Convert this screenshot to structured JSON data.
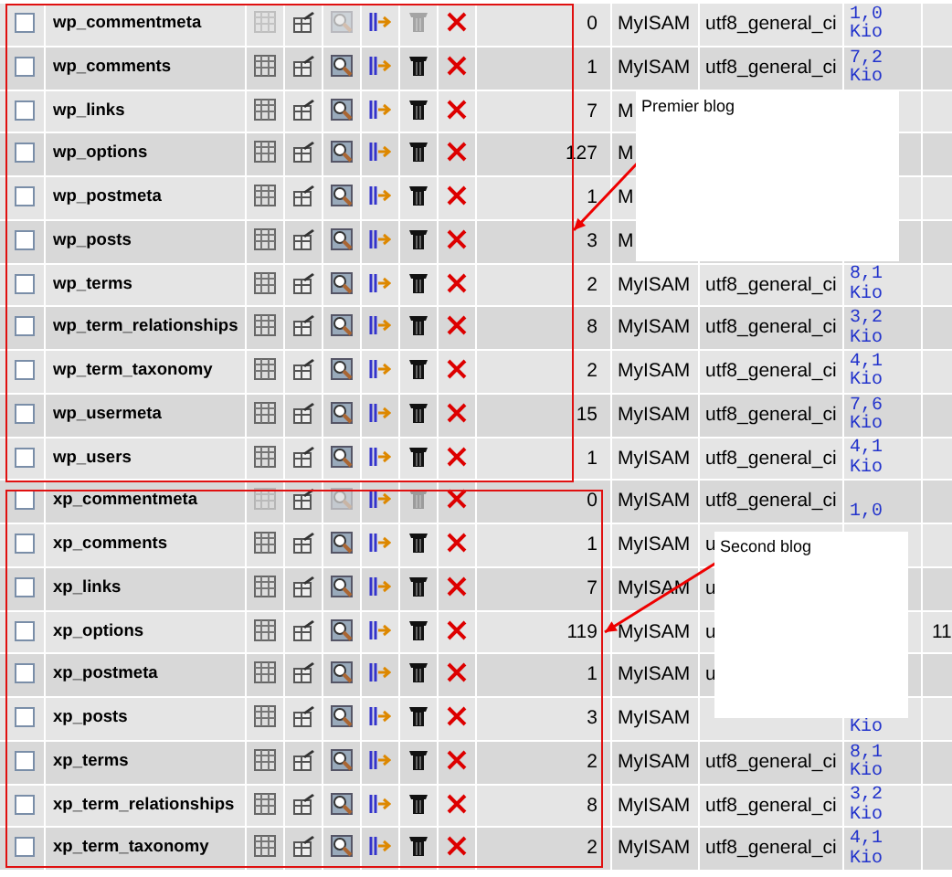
{
  "groups": [
    {
      "label": "Premier blog",
      "rows": [
        {
          "name": "wp_commentmeta",
          "checked": false,
          "records": "0",
          "engine": "MyISAM",
          "collation": "utf8_general_ci",
          "size": "1,0 Kio",
          "icons_disabled": true
        },
        {
          "name": "wp_comments",
          "checked": false,
          "records": "1",
          "engine": "MyISAM",
          "collation": "utf8_general_ci",
          "size": "7,2 Kio",
          "icons_disabled": false
        },
        {
          "name": "wp_links",
          "checked": false,
          "records": "7",
          "engine": "M",
          "icons_disabled": false
        },
        {
          "name": "wp_options",
          "checked": false,
          "records": "127",
          "engine": "M",
          "icons_disabled": false
        },
        {
          "name": "wp_postmeta",
          "checked": false,
          "records": "1",
          "engine": "M",
          "icons_disabled": false
        },
        {
          "name": "wp_posts",
          "checked": false,
          "records": "3",
          "engine": "M",
          "icons_disabled": false
        },
        {
          "name": "wp_terms",
          "checked": false,
          "records": "2",
          "engine": "MyISAM",
          "collation": "utf8_general_ci",
          "size": "8,1 Kio",
          "icons_disabled": false
        },
        {
          "name": "wp_term_relationships",
          "checked": false,
          "records": "8",
          "engine": "MyISAM",
          "collation": "utf8_general_ci",
          "size": "3,2 Kio",
          "icons_disabled": false
        },
        {
          "name": "wp_term_taxonomy",
          "checked": false,
          "records": "2",
          "engine": "MyISAM",
          "collation": "utf8_general_ci",
          "size": "4,1 Kio",
          "icons_disabled": false
        },
        {
          "name": "wp_usermeta",
          "checked": false,
          "records": "15",
          "engine": "MyISAM",
          "collation": "utf8_general_ci",
          "size": "7,6 Kio",
          "icons_disabled": false
        },
        {
          "name": "wp_users",
          "checked": false,
          "records": "1",
          "engine": "MyISAM",
          "collation": "utf8_general_ci",
          "size": "4,1 Kio",
          "icons_disabled": false
        }
      ]
    },
    {
      "label": "Second blog",
      "rows": [
        {
          "name": "xp_commentmeta",
          "checked": false,
          "records": "0",
          "engine": "MyISAM",
          "collation": "utf8_general_ci",
          "size": "1,0",
          "icons_disabled": true
        },
        {
          "name": "xp_comments",
          "checked": false,
          "records": "1",
          "engine": "MyISAM",
          "collation": "u",
          "icons_disabled": false
        },
        {
          "name": "xp_links",
          "checked": false,
          "records": "7",
          "engine": "MyISAM",
          "collation": "u",
          "icons_disabled": false
        },
        {
          "name": "xp_options",
          "checked": false,
          "records": "119",
          "engine": "MyISAM",
          "collation": "u",
          "extra": "11",
          "icons_disabled": false
        },
        {
          "name": "xp_postmeta",
          "checked": false,
          "records": "1",
          "engine": "MyISAM",
          "collation": "u",
          "icons_disabled": false
        },
        {
          "name": "xp_posts",
          "checked": false,
          "records": "3",
          "engine": "MyISAM",
          "size": "Kio",
          "icons_disabled": false
        },
        {
          "name": "xp_terms",
          "checked": false,
          "records": "2",
          "engine": "MyISAM",
          "collation": "utf8_general_ci",
          "size": "8,1 Kio",
          "icons_disabled": false
        },
        {
          "name": "xp_term_relationships",
          "checked": false,
          "records": "8",
          "engine": "MyISAM",
          "collation": "utf8_general_ci",
          "size": "3,2 Kio",
          "icons_disabled": false
        },
        {
          "name": "xp_term_taxonomy",
          "checked": false,
          "records": "2",
          "engine": "MyISAM",
          "collation": "utf8_general_ci",
          "size": "4,1 Kio",
          "icons_disabled": false
        }
      ]
    }
  ]
}
